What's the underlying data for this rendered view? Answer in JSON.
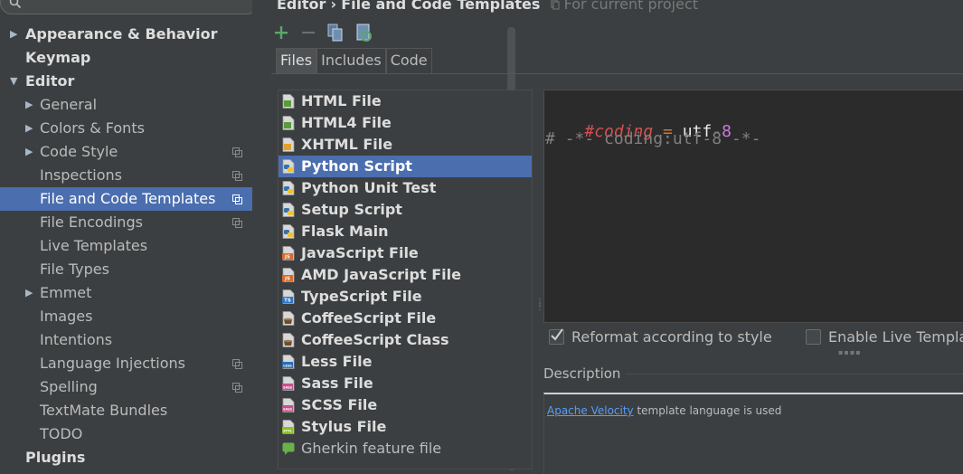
{
  "breadcrumb": {
    "parent": "Editor",
    "separator": "›",
    "current": "File and Code Templates",
    "scope_hint": "For current project"
  },
  "tree": [
    {
      "label": "Appearance & Behavior",
      "level": 0,
      "arrow": "▶",
      "copy": false,
      "selected": false
    },
    {
      "label": "Keymap",
      "level": 0,
      "arrow": "",
      "copy": false,
      "selected": false
    },
    {
      "label": "Editor",
      "level": 0,
      "arrow": "▼",
      "copy": false,
      "selected": false
    },
    {
      "label": "General",
      "level": 1,
      "arrow": "▶",
      "copy": false,
      "selected": false
    },
    {
      "label": "Colors & Fonts",
      "level": 1,
      "arrow": "▶",
      "copy": false,
      "selected": false
    },
    {
      "label": "Code Style",
      "level": 1,
      "arrow": "▶",
      "copy": true,
      "selected": false
    },
    {
      "label": "Inspections",
      "level": 1,
      "arrow": "",
      "copy": true,
      "selected": false
    },
    {
      "label": "File and Code Templates",
      "level": 1,
      "arrow": "",
      "copy": true,
      "selected": true
    },
    {
      "label": "File Encodings",
      "level": 1,
      "arrow": "",
      "copy": true,
      "selected": false
    },
    {
      "label": "Live Templates",
      "level": 1,
      "arrow": "",
      "copy": false,
      "selected": false
    },
    {
      "label": "File Types",
      "level": 1,
      "arrow": "",
      "copy": false,
      "selected": false
    },
    {
      "label": "Emmet",
      "level": 1,
      "arrow": "▶",
      "copy": false,
      "selected": false
    },
    {
      "label": "Images",
      "level": 1,
      "arrow": "",
      "copy": false,
      "selected": false
    },
    {
      "label": "Intentions",
      "level": 1,
      "arrow": "",
      "copy": false,
      "selected": false
    },
    {
      "label": "Language Injections",
      "level": 1,
      "arrow": "",
      "copy": true,
      "selected": false
    },
    {
      "label": "Spelling",
      "level": 1,
      "arrow": "",
      "copy": true,
      "selected": false
    },
    {
      "label": "TextMate Bundles",
      "level": 1,
      "arrow": "",
      "copy": false,
      "selected": false
    },
    {
      "label": "TODO",
      "level": 1,
      "arrow": "",
      "copy": false,
      "selected": false
    },
    {
      "label": "Plugins",
      "level": 0,
      "arrow": "",
      "copy": false,
      "selected": false
    }
  ],
  "toolbar": [
    {
      "name": "add-template-button",
      "icon": "plus-icon"
    },
    {
      "name": "remove-template-button",
      "icon": "minus-icon"
    },
    {
      "name": "copy-template-button",
      "icon": "copy-icon"
    },
    {
      "name": "reset-template-button",
      "icon": "reset-icon"
    }
  ],
  "tabs": [
    {
      "label": "Files",
      "active": true
    },
    {
      "label": "Includes",
      "active": false
    },
    {
      "label": "Code",
      "active": false
    }
  ],
  "templates": [
    {
      "label": "HTML File",
      "icon": "html-file-icon",
      "color": "#5a9b3a",
      "badge": "",
      "bold": true,
      "selected": false
    },
    {
      "label": "HTML4 File",
      "icon": "html-file-icon",
      "color": "#5a9b3a",
      "badge": "",
      "bold": true,
      "selected": false
    },
    {
      "label": "XHTML File",
      "icon": "xhtml-file-icon",
      "color": "#e0a030",
      "badge": "",
      "bold": true,
      "selected": false
    },
    {
      "label": "Python Script",
      "icon": "python-file-icon",
      "color": "#3572a5",
      "badge": "",
      "bold": true,
      "selected": true
    },
    {
      "label": "Python Unit Test",
      "icon": "python-file-icon",
      "color": "#3572a5",
      "badge": "",
      "bold": true,
      "selected": false
    },
    {
      "label": "Setup Script",
      "icon": "python-file-icon",
      "color": "#3572a5",
      "badge": "",
      "bold": true,
      "selected": false
    },
    {
      "label": "Flask Main",
      "icon": "python-file-icon",
      "color": "#3572a5",
      "badge": "",
      "bold": true,
      "selected": false
    },
    {
      "label": "JavaScript File",
      "icon": "javascript-file-icon",
      "color": "#d96a2b",
      "badge": "JS",
      "bold": true,
      "selected": false
    },
    {
      "label": "AMD JavaScript File",
      "icon": "javascript-file-icon",
      "color": "#d96a2b",
      "badge": "JS",
      "bold": true,
      "selected": false
    },
    {
      "label": "TypeScript File",
      "icon": "typescript-file-icon",
      "color": "#2f74c0",
      "badge": "TS",
      "bold": true,
      "selected": false
    },
    {
      "label": "CoffeeScript File",
      "icon": "coffeescript-file-icon",
      "color": "#c8c8c8",
      "badge": "",
      "bold": true,
      "selected": false
    },
    {
      "label": "CoffeeScript Class",
      "icon": "coffeescript-file-icon",
      "color": "#c8c8c8",
      "badge": "",
      "bold": true,
      "selected": false
    },
    {
      "label": "Less File",
      "icon": "less-file-icon",
      "color": "#2a6fb8",
      "badge": "LESS",
      "bold": true,
      "selected": false
    },
    {
      "label": "Sass File",
      "icon": "sass-file-icon",
      "color": "#c6538c",
      "badge": "SASS",
      "bold": true,
      "selected": false
    },
    {
      "label": "SCSS File",
      "icon": "scss-file-icon",
      "color": "#c6538c",
      "badge": "SASS",
      "bold": true,
      "selected": false
    },
    {
      "label": "Stylus File",
      "icon": "stylus-file-icon",
      "color": "#8cbf26",
      "badge": "STYL",
      "bold": true,
      "selected": false
    },
    {
      "label": "Gherkin feature file",
      "icon": "gherkin-file-icon",
      "color": "#6ab04c",
      "badge": "",
      "bold": false,
      "selected": false
    }
  ],
  "editor": {
    "line1": {
      "directive": "#coding",
      "op": " = ",
      "text": "utf",
      "dash": "-",
      "num": "8"
    },
    "line2": {
      "comment": "# -*- coding:utf-8 -*-"
    }
  },
  "options": {
    "reformat": {
      "label": "Reformat according to style",
      "checked": true
    },
    "live_templates": {
      "label": "Enable Live Templates",
      "checked": false
    }
  },
  "description": {
    "title": "Description",
    "link": "Apache Velocity",
    "text": " template language is used"
  },
  "colors": {
    "selection": "#4b6eaf",
    "panel": "#3c3f41",
    "editor_bg": "#2b2b2b",
    "link": "#589df6"
  }
}
